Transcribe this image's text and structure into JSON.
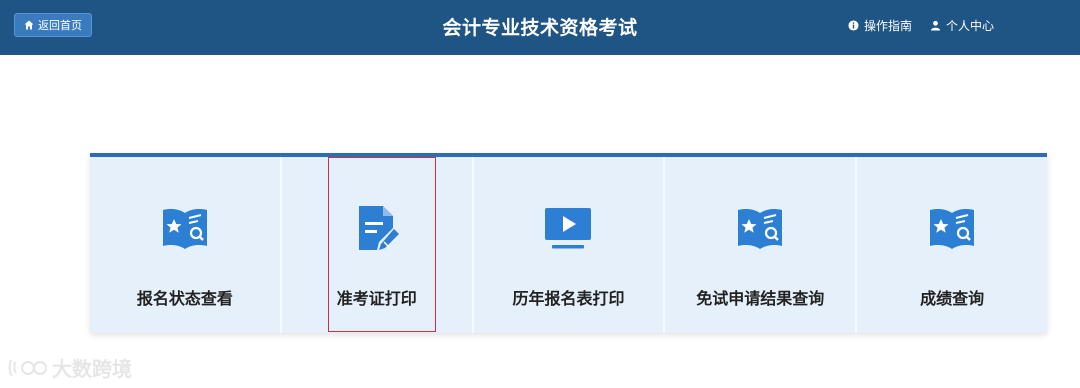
{
  "header": {
    "home_label": "返回首页",
    "title": "会计专业技术资格考试",
    "guide_label": "操作指南",
    "user_label": "个人中心"
  },
  "cards": [
    {
      "label": "报名状态查看",
      "icon": "book-star-search-icon"
    },
    {
      "label": "准考证打印",
      "icon": "document-edit-icon"
    },
    {
      "label": "历年报名表打印",
      "icon": "monitor-play-icon"
    },
    {
      "label": "免试申请结果查询",
      "icon": "book-star-search-icon"
    },
    {
      "label": "成绩查询",
      "icon": "book-star-search-icon"
    }
  ],
  "watermark": "大数跨境",
  "colors": {
    "header_bg": "#1f5584",
    "accent": "#2a6db5",
    "icon_blue": "#2d7fd3",
    "card_bg": "#e6f0fb",
    "highlight_border": "#d0303a"
  }
}
